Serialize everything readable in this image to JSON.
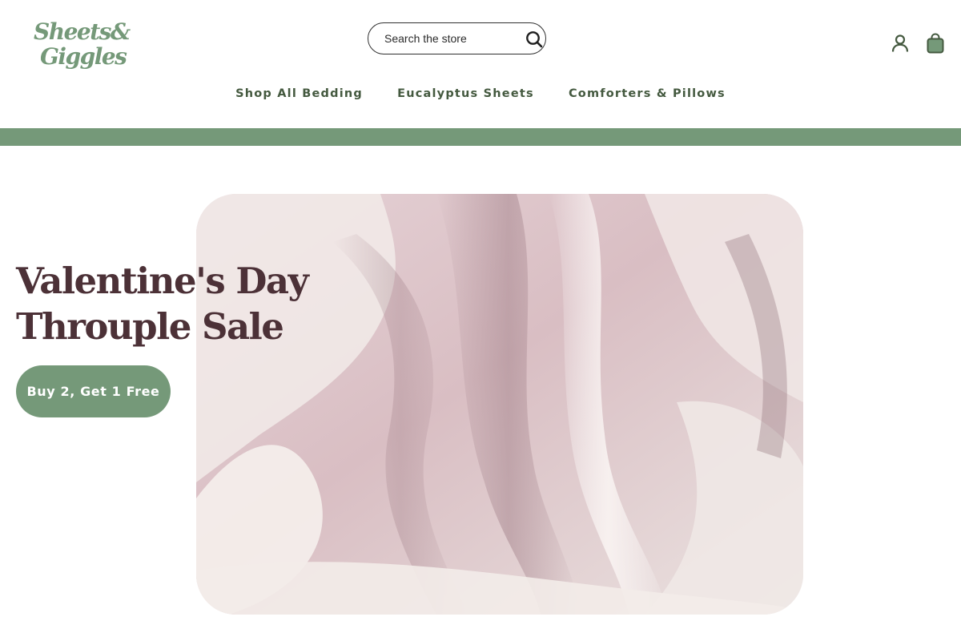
{
  "brand": {
    "name": "Sheets & Giggles",
    "logo_line1": "Sheets&",
    "logo_line2": "Giggles",
    "color_primary": "#759979",
    "color_nav_text": "#44593f",
    "color_headline": "#4c3137"
  },
  "header": {
    "search": {
      "placeholder": "Search the store",
      "value": ""
    },
    "icons": {
      "search": "search-icon",
      "account": "account-icon",
      "cart": "shopping-bag-icon"
    }
  },
  "nav": {
    "items": [
      {
        "label": "Shop All Bedding"
      },
      {
        "label": "Eucalyptus Sheets"
      },
      {
        "label": "Comforters & Pillows"
      }
    ]
  },
  "hero": {
    "headline_line1": "Valentine's Day",
    "headline_line2": "Throuple Sale",
    "cta_label": "Buy 2, Get 1 Free",
    "image": "pink silk fabric"
  }
}
